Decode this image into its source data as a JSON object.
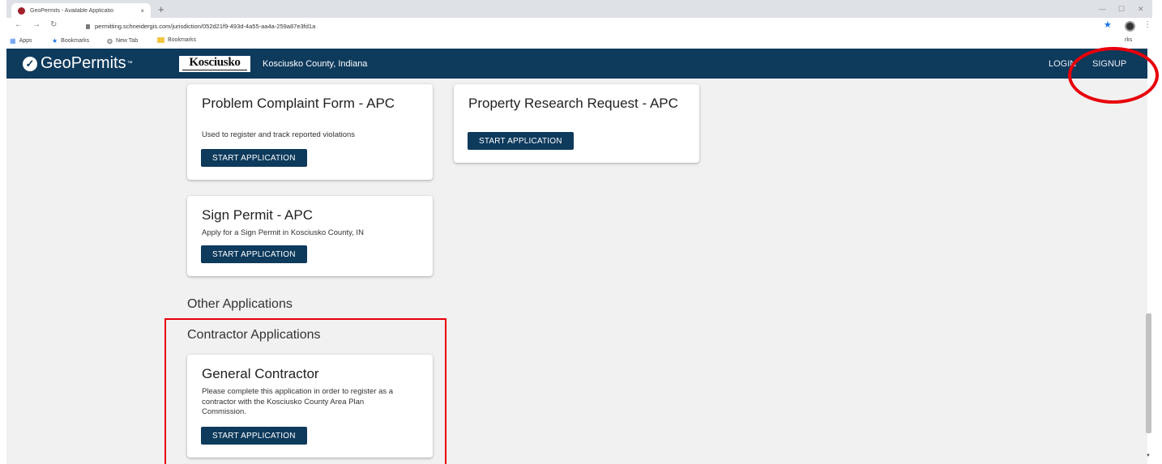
{
  "browser": {
    "tab_title": "GeoPermits - Available Applicatio",
    "tab_close": "×",
    "new_tab": "+",
    "url": "permitting.schneidergis.com/jurisdiction/052d21f9-493d-4a55-aa4a-259a87e3fd1a",
    "bookmarks": [
      {
        "label": "Apps",
        "icon": "apps-grid-icon"
      },
      {
        "label": "Bookmarks",
        "icon": "star-icon"
      },
      {
        "label": "New Tab",
        "icon": "globe-icon"
      },
      {
        "label": "Bookmarks",
        "icon": "folder-icon"
      }
    ],
    "other_bookmarks_partial": "rks"
  },
  "header": {
    "brand": "GeoPermits",
    "brand_tm": "™",
    "county_logo": "Kosciusko",
    "jurisdiction": "Kosciusko County, Indiana",
    "login": "LOGIN",
    "signup": "SIGNUP",
    "color": "#0e3a5c"
  },
  "cards": {
    "problem_complaint": {
      "title": "Problem Complaint Form - APC",
      "description": "Used to register and track reported violations",
      "button": "START APPLICATION"
    },
    "property_research": {
      "title": "Property Research Request - APC",
      "button": "START APPLICATION"
    },
    "sign_permit": {
      "title": "Sign Permit - APC",
      "description": "Apply for a Sign Permit in Kosciusko County, IN",
      "button": "START APPLICATION"
    },
    "general_contractor": {
      "title": "General Contractor",
      "description": "Please complete this application in order to register as a contractor with the Kosciusko County Area Plan Commission.",
      "button": "START APPLICATION"
    }
  },
  "sections": {
    "other": "Other Applications",
    "contractor": "Contractor Applications"
  },
  "annotations": {
    "color": "#e8000b"
  }
}
